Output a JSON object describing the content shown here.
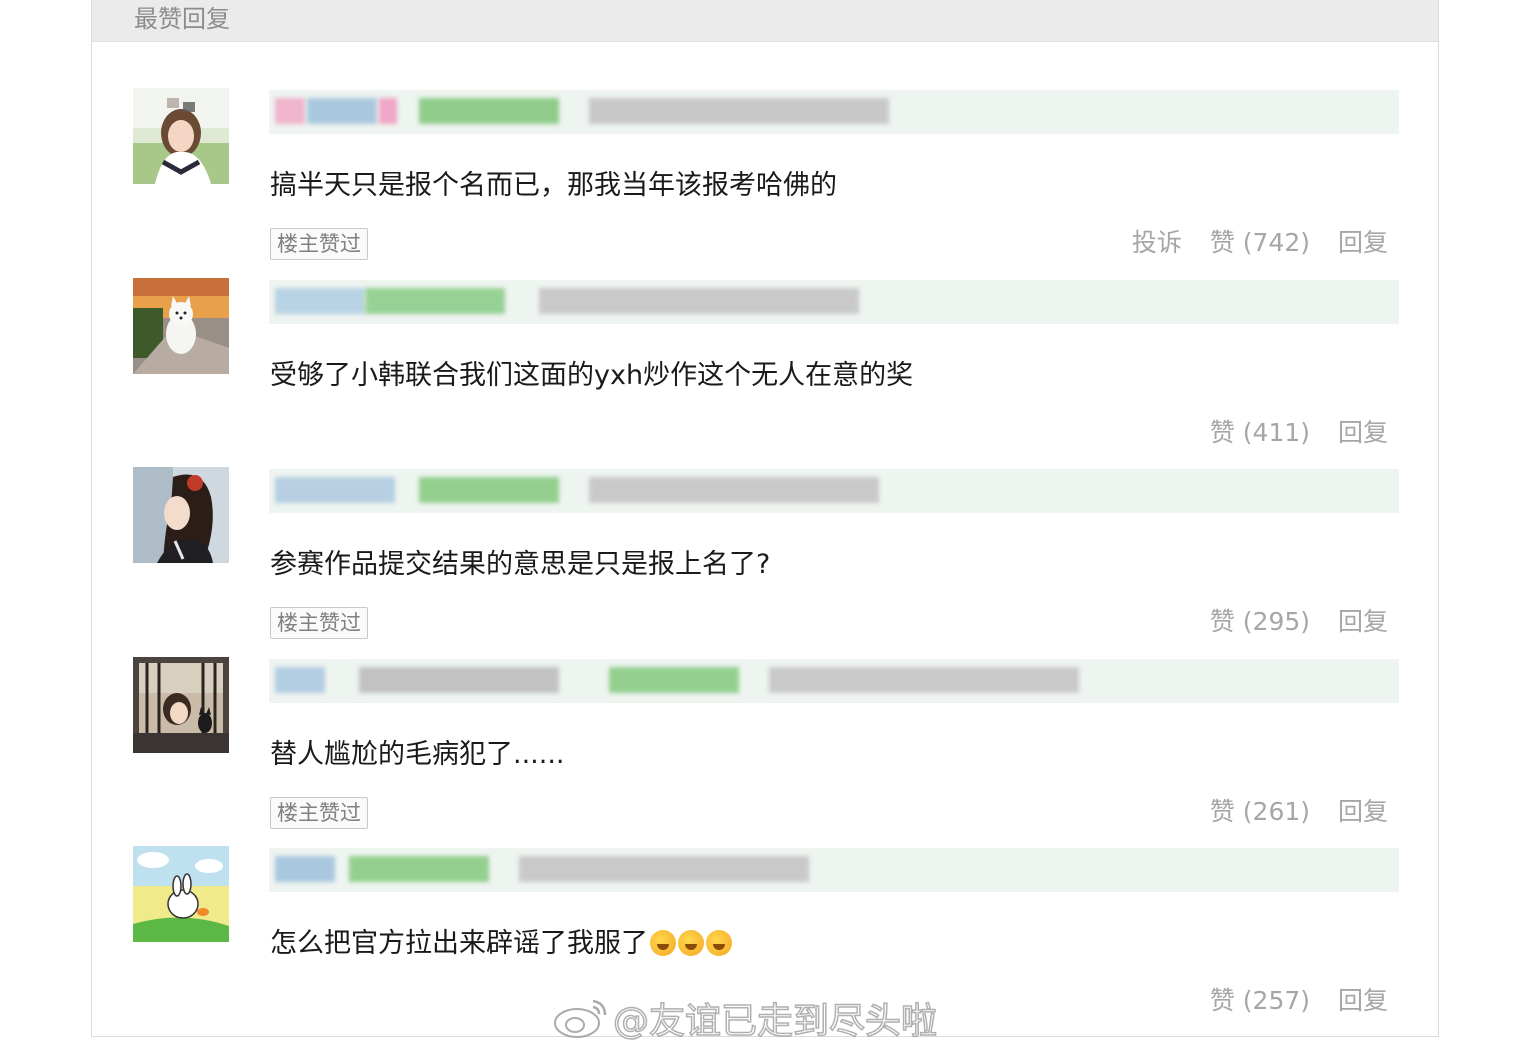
{
  "header": {
    "title": "最赞回复"
  },
  "comments": [
    {
      "text": "搞半天只是报个名而已，那我当年该报考哈佛的",
      "op_liked": true,
      "op_badge": "楼主赞过",
      "report": "投诉",
      "likes": "赞 (742)",
      "reply": "回复",
      "avatar_icon": "girl-portrait-avatar"
    },
    {
      "text": "受够了小韩联合我们这面的yxh炒作这个无人在意的奖",
      "op_liked": false,
      "op_badge": "",
      "report": "",
      "likes": "赞 (411)",
      "reply": "回复",
      "avatar_icon": "white-dog-avatar"
    },
    {
      "text": "参赛作品提交结果的意思是只是报上名了?",
      "op_liked": true,
      "op_badge": "楼主赞过",
      "report": "",
      "likes": "赞 (295)",
      "reply": "回复",
      "avatar_icon": "woman-profile-avatar"
    },
    {
      "text": "替人尴尬的毛病犯了......",
      "op_liked": true,
      "op_badge": "楼主赞过",
      "report": "",
      "likes": "赞 (261)",
      "reply": "回复",
      "avatar_icon": "anime-girl-cat-avatar"
    },
    {
      "text": "怎么把官方拉出来辟谣了我服了",
      "emoji_count": 3,
      "op_liked": false,
      "op_badge": "",
      "report": "",
      "likes": "赞 (257)",
      "reply": "回复",
      "avatar_icon": "cartoon-rabbit-avatar"
    }
  ],
  "watermark": "@友谊已走到尽头啦",
  "colors": {
    "header_bg": "#ebebeb",
    "name_bar_bg": "#eef4f0",
    "action_text": "#a6a6a6",
    "comment_text": "#1a1a1a"
  }
}
